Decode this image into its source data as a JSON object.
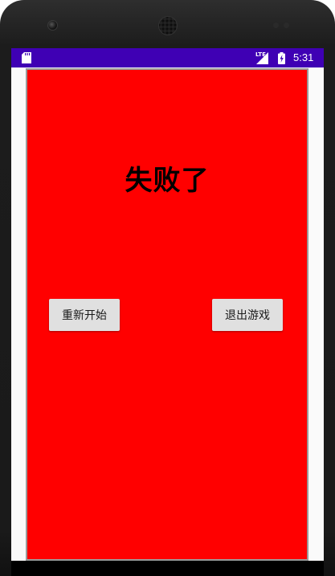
{
  "status_bar": {
    "network": "LTE",
    "time": "5:31",
    "icons": [
      "sd-card-icon",
      "signal-icon",
      "battery-charging-icon"
    ],
    "background_color": "#3f00b4"
  },
  "game_over": {
    "title": "失败了",
    "background_color": "#ff0000",
    "buttons": {
      "restart_label": "重新开始",
      "quit_label": "退出游戏"
    }
  }
}
